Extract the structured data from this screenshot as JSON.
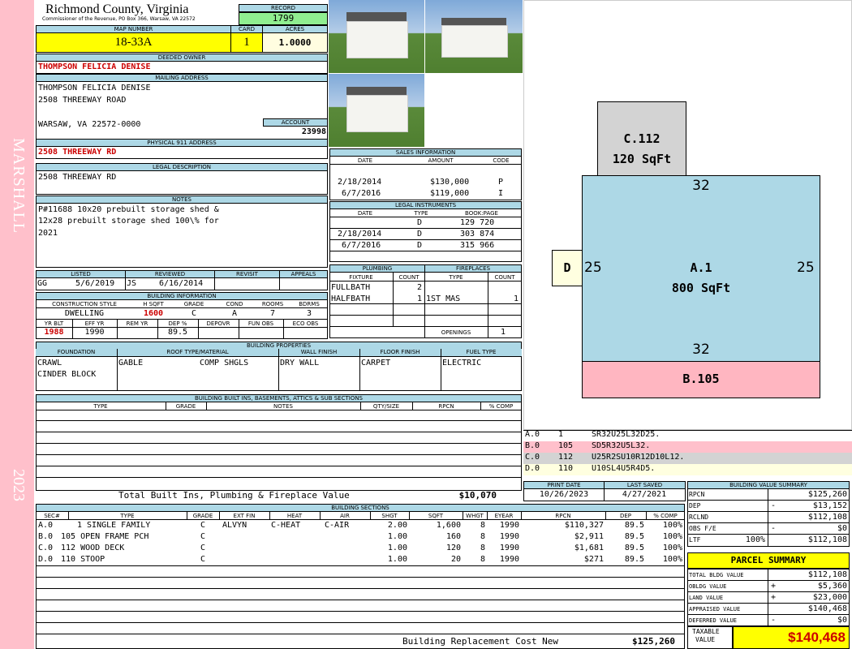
{
  "side": {
    "district": "MARSHALL",
    "year": "2023"
  },
  "header": {
    "county": "Richmond County, Virginia",
    "commissioner": "Commissioner of the Revenue, PO Box 366, Warsaw, VA 22572",
    "record_label": "RECORD",
    "record": "1799"
  },
  "map": {
    "map_label": "MAP NUMBER",
    "map_number": "18-33A",
    "card_label": "CARD",
    "card": "1",
    "acres_label": "ACRES",
    "acres": "1.0000"
  },
  "owner": {
    "deeded_label": "DEEDED OWNER",
    "deeded_owner": "THOMPSON FELICIA DENISE",
    "mailing_label": "MAILING ADDRESS",
    "mailing_lines": [
      "THOMPSON FELICIA DENISE",
      "2508 THREEWAY ROAD",
      "",
      "WARSAW, VA 22572-0000"
    ],
    "account_label": "ACCOUNT",
    "account": "23998",
    "physical_label": "PHYSICAL 911 ADDRESS",
    "physical": "2508 THREEWAY RD"
  },
  "legal": {
    "label": "LEGAL DESCRIPTION",
    "text": "2508 THREEWAY RD"
  },
  "notes": {
    "label": "NOTES",
    "lines": [
      "P#11688 10x20 prebuilt storage shed &",
      "12x28 prebuilt storage shed 100\\% for",
      "2021"
    ]
  },
  "listed": {
    "listed_label": "LISTED",
    "reviewed_label": "REVIEWED",
    "revisit_label": "REVISIT",
    "appeals_label": "APPEALS",
    "listed_by": "GG",
    "listed_date": "5/6/2019",
    "reviewed_by": "JS",
    "reviewed_date": "6/16/2014"
  },
  "building_info": {
    "label": "BUILDING INFORMATION",
    "headers": [
      "CONSTRUCTION STYLE",
      "H SQFT",
      "GRADE",
      "COND",
      "ROOMS",
      "BDRMS"
    ],
    "values": [
      "DWELLING",
      "1600",
      "C",
      "A",
      "7",
      "3"
    ],
    "headers2": [
      "YR BLT",
      "EFF YR",
      "REM YR",
      "DEP %",
      "DEPOVR",
      "FUN OBS",
      "ECO OBS"
    ],
    "values2": [
      "1988",
      "1990",
      "",
      "89.5",
      "",
      "",
      ""
    ]
  },
  "sales": {
    "label": "SALES INFORMATION",
    "headers": [
      "DATE",
      "AMOUNT",
      "CODE"
    ],
    "rows": [
      [
        "2/18/2014",
        "$130,000",
        "P"
      ],
      [
        "6/7/2016",
        "$119,000",
        "I"
      ]
    ]
  },
  "legal_instruments": {
    "label": "LEGAL INSTRUMENTS",
    "headers": [
      "DATE",
      "TYPE",
      "BOOK:PAGE"
    ],
    "rows": [
      [
        "",
        "D",
        "129 720"
      ],
      [
        "2/18/2014",
        "D",
        "303 874"
      ],
      [
        "6/7/2016",
        "D",
        "315 966"
      ]
    ]
  },
  "plumbing": {
    "label": "PLUMBING",
    "headers": [
      "FIXTURE",
      "COUNT"
    ],
    "rows": [
      [
        "FULLBATH",
        "2"
      ],
      [
        "HALFBATH",
        "1"
      ]
    ]
  },
  "fireplaces": {
    "label": "FIREPLACES",
    "headers": [
      "TYPE",
      "COUNT"
    ],
    "rows": [
      [
        "1ST MAS",
        "1"
      ]
    ],
    "openings_label": "OPENINGS",
    "openings": "1"
  },
  "building_props": {
    "label": "BUILDING PROPERTIES",
    "foundation_label": "FOUNDATION",
    "foundation": [
      "CRAWL",
      "CINDER BLOCK"
    ],
    "roof_label": "ROOF TYPE/MATERIAL",
    "roof_type": "GABLE",
    "roof_material": "COMP SHGLS",
    "wall_label": "WALL FINISH",
    "wall": "DRY WALL",
    "floor_label": "FLOOR FINISH",
    "floor": "CARPET",
    "fuel_label": "FUEL TYPE",
    "fuel": "ELECTRIC"
  },
  "builtins": {
    "label": "BUILDING BUILT INS, BASEMENTS, ATTICS & SUB SECTIONS",
    "headers": [
      "TYPE",
      "GRADE",
      "NOTES",
      "QTY/SIZE",
      "RPCN",
      "% COMP"
    ],
    "total_label": "Total Built Ins, Plumbing & Fireplace Value",
    "total": "$10,070"
  },
  "sketch": {
    "c_label": "C.112",
    "c_area": "120 SqFt",
    "a_label": "A.1",
    "a_area": "800 SqFt",
    "b_label": "B.105",
    "d_label": "D",
    "top": "32",
    "bottom": "32",
    "left": "25",
    "right": "25"
  },
  "legend": [
    {
      "code": "A.0",
      "num": "1",
      "desc": "SR32U25L32D25.",
      "color": "#ffffff"
    },
    {
      "code": "B.0",
      "num": "105",
      "desc": "SD5R32U5L32.",
      "color": "#ffc0cb"
    },
    {
      "code": "C.0",
      "num": "112",
      "desc": "U25R2SU10R12D10L12.",
      "color": "#d3d3d3"
    },
    {
      "code": "D.0",
      "num": "110",
      "desc": "U10SL4U5R4D5.",
      "color": "#ffffe0"
    }
  ],
  "dates": {
    "print_label": "PRINT DATE",
    "print": "10/26/2023",
    "saved_label": "LAST SAVED",
    "saved": "4/27/2021"
  },
  "sections": {
    "label": "BUILDING SECTIONS",
    "headers": [
      "SEC#",
      "TYPE",
      "GRADE",
      "EXT FIN",
      "HEAT",
      "AIR",
      "SHGT",
      "SQFT",
      "WHGT",
      "EYEAR",
      "RPCN",
      "DEP",
      "% COMP"
    ],
    "rows": [
      [
        "A.0",
        "1 SINGLE FAMILY",
        "C",
        "ALVYN",
        "C-HEAT",
        "C-AIR",
        "2.00",
        "1,600",
        "8",
        "1990",
        "$110,327",
        "89.5",
        "100%"
      ],
      [
        "B.0",
        "105 OPEN FRAME PCH",
        "C",
        "",
        "",
        "",
        "1.00",
        "160",
        "8",
        "1990",
        "$2,911",
        "89.5",
        "100%"
      ],
      [
        "C.0",
        "112 WOOD DECK",
        "C",
        "",
        "",
        "",
        "1.00",
        "120",
        "8",
        "1990",
        "$1,681",
        "89.5",
        "100%"
      ],
      [
        "D.0",
        "110 STOOP",
        "C",
        "",
        "",
        "",
        "1.00",
        "20",
        "8",
        "1990",
        "$271",
        "89.5",
        "100%"
      ]
    ],
    "replacement_label": "Building Replacement Cost New",
    "replacement": "$125,260"
  },
  "value_summary": {
    "label": "BUILDING VALUE SUMMARY",
    "rows": [
      [
        "RPCN",
        "",
        "$125,260"
      ],
      [
        "DEP",
        "-",
        "$13,152"
      ],
      [
        "RCLND",
        "",
        "$112,108"
      ],
      [
        "OBS F/E",
        "-",
        "$0"
      ],
      [
        "LTF",
        "100%",
        "$112,108"
      ]
    ]
  },
  "parcel": {
    "label": "PARCEL SUMMARY",
    "rows": [
      [
        "TOTAL BLDG VALUE",
        "",
        "$112,108"
      ],
      [
        "OBLDG VALUE",
        "+",
        "$5,360"
      ],
      [
        "LAND VALUE",
        "+",
        "$23,000"
      ],
      [
        "APPRAISED VALUE",
        "",
        "$140,468"
      ],
      [
        "DEFERRED VALUE",
        "-",
        "$0"
      ]
    ],
    "taxable_label1": "TAXABLE",
    "taxable_label2": "VALUE",
    "taxable": "$140,468"
  }
}
